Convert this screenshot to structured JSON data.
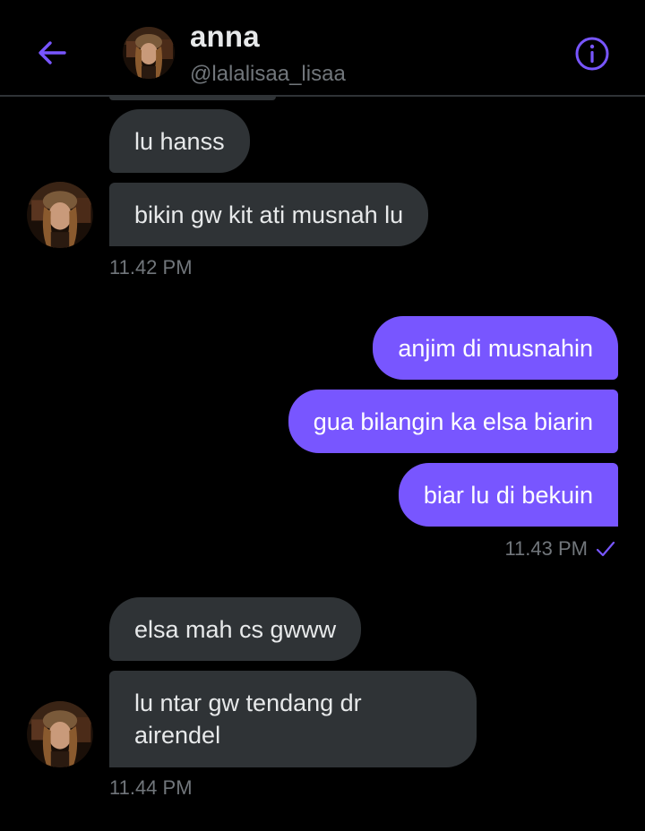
{
  "header": {
    "name": "anna",
    "handle": "@lalalisaa_lisaa",
    "accent_color": "#7856ff",
    "back_icon": "arrow-left-icon",
    "info_icon": "info-circle-icon"
  },
  "conversation": {
    "group1": {
      "messages": [
        "lu hanss",
        "bikin gw kit ati musnah lu"
      ],
      "time": "11.42 PM"
    },
    "group2": {
      "messages": [
        "anjim di musnahin",
        "gua bilangin ka elsa biarin",
        "biar lu di bekuin"
      ],
      "time": "11.43 PM",
      "status_icon": "check-icon"
    },
    "group3": {
      "messages": [
        "elsa mah cs gwww",
        "lu ntar gw tendang dr airendel"
      ],
      "time": "11.44 PM"
    }
  },
  "colors": {
    "background": "#000000",
    "incoming_bubble": "#2f3336",
    "outgoing_bubble": "#7856ff",
    "muted_text": "#71767b"
  }
}
